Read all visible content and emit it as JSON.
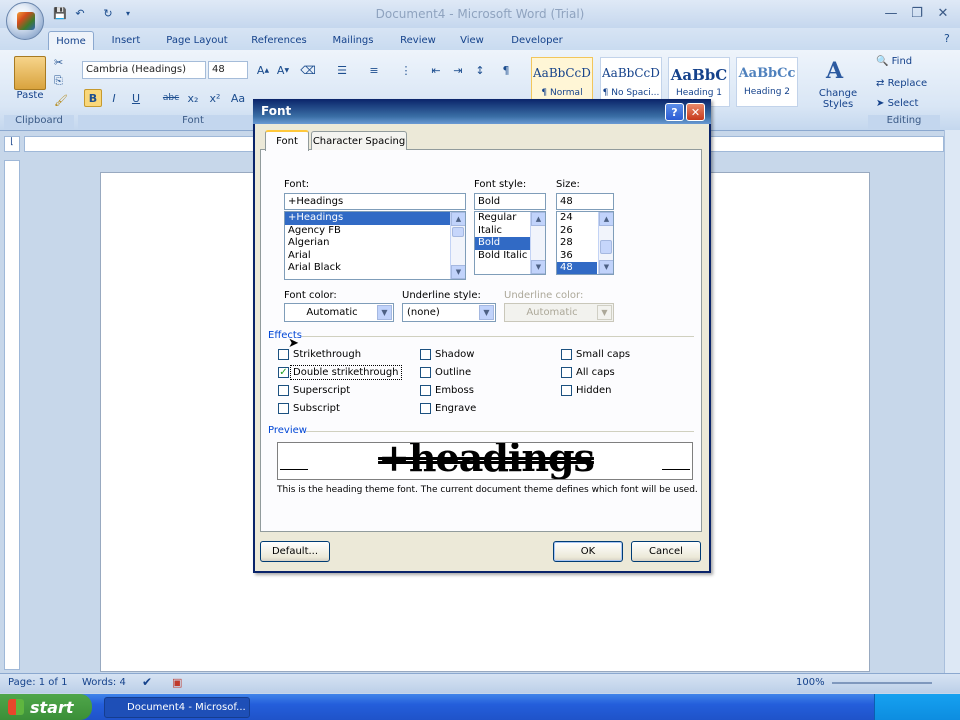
{
  "window": {
    "title": "Document4 - Microsoft Word (Trial)"
  },
  "quick_access": [
    "save-icon",
    "undo-icon",
    "redo-icon"
  ],
  "tabs": [
    "Home",
    "Insert",
    "Page Layout",
    "References",
    "Mailings",
    "Review",
    "View",
    "Developer"
  ],
  "ribbon": {
    "clipboard": {
      "paste_label": "Paste",
      "group_label": "Clipboard"
    },
    "font": {
      "font_name": "Cambria (Headings)",
      "font_size": "48",
      "group_label": "Font",
      "bold": "B",
      "italic": "I",
      "underline": "U",
      "strike": "abc",
      "subscript": "x₂",
      "superscript": "x²",
      "case": "Aa"
    },
    "styles": [
      {
        "sample": "AaBbCcDc",
        "name": "¶ Normal"
      },
      {
        "sample": "AaBbCcDc",
        "name": "¶ No Spaci..."
      },
      {
        "sample": "AaBbC",
        "name": "Heading 1"
      },
      {
        "sample": "AaBbCc",
        "name": "Heading 2"
      }
    ],
    "change_styles": "Change Styles",
    "editing": {
      "find": "Find",
      "replace": "Replace",
      "select": "Select",
      "group_label": "Editing"
    }
  },
  "statusbar": {
    "page": "Page: 1 of 1",
    "words": "Words: 4",
    "zoom": "100%"
  },
  "taskbar": {
    "start": "start",
    "item": "Document4 - Microsof..."
  },
  "dialog": {
    "title": "Font",
    "help": "?",
    "close": "✕",
    "tabs": [
      "Font",
      "Character Spacing"
    ],
    "font_label": "Font:",
    "font_value": "+Headings",
    "font_list": [
      "+Headings",
      "Agency FB",
      "Algerian",
      "Arial",
      "Arial Black"
    ],
    "style_label": "Font style:",
    "style_value": "Bold",
    "style_list": [
      "Regular",
      "Italic",
      "Bold",
      "Bold Italic"
    ],
    "size_label": "Size:",
    "size_value": "48",
    "size_list": [
      "24",
      "26",
      "28",
      "36",
      "48"
    ],
    "font_color_label": "Font color:",
    "font_color_value": "Automatic",
    "underline_style_label": "Underline style:",
    "underline_style_value": "(none)",
    "underline_color_label": "Underline color:",
    "underline_color_value": "Automatic",
    "effects_label": "Effects",
    "effects": [
      {
        "label": "Strikethrough",
        "checked": false
      },
      {
        "label": "Double strikethrough",
        "checked": true
      },
      {
        "label": "Superscript",
        "checked": false
      },
      {
        "label": "Subscript",
        "checked": false
      },
      {
        "label": "Shadow",
        "checked": false
      },
      {
        "label": "Outline",
        "checked": false
      },
      {
        "label": "Emboss",
        "checked": false
      },
      {
        "label": "Engrave",
        "checked": false
      },
      {
        "label": "Small caps",
        "checked": false
      },
      {
        "label": "All caps",
        "checked": false
      },
      {
        "label": "Hidden",
        "checked": false
      }
    ],
    "preview_label": "Preview",
    "preview_text": "+headings",
    "preview_note": "This is the heading theme font. The current document theme defines which font will be used.",
    "default_button": "Default...",
    "ok_button": "OK",
    "cancel_button": "Cancel"
  }
}
